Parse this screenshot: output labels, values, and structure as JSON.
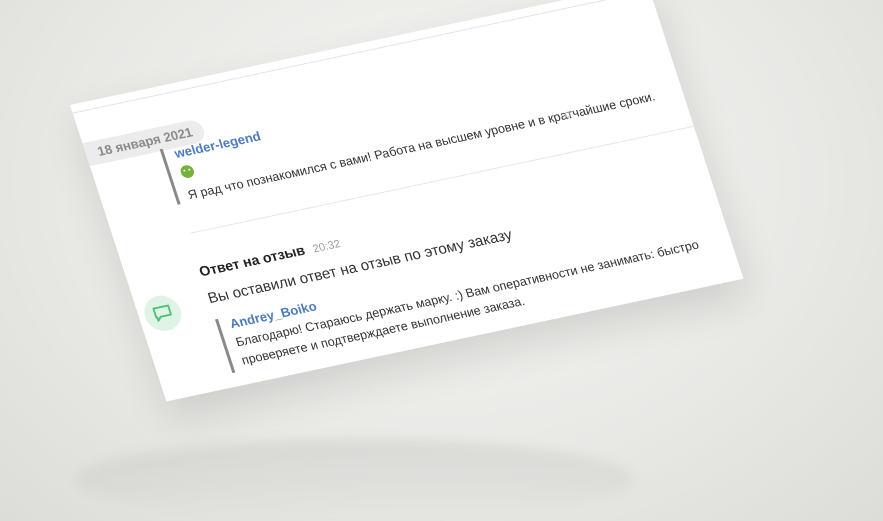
{
  "feed": {
    "date": "18 января 2021",
    "review": {
      "author": "welder-legend",
      "emoji": "smiley-icon",
      "text": "Я рад что познакомился с вами! Работа на высшем уровне и в кратчайшие  сроки."
    },
    "event": {
      "icon": "chat-bubble-icon",
      "title": "Ответ на отзыв",
      "time": "20:32",
      "description": "Вы оставили ответ на отзыв по этому заказу",
      "reply": {
        "author": "Andrey_Boiko",
        "line1": "Благодарю! Стараюсь держать марку. :) Вам оперативности не занимать: быстро",
        "line2": "проверяете и подтверждаете выполнение заказа."
      }
    }
  },
  "colors": {
    "author_link": "#4d7bc0",
    "emoji": "#74b23a",
    "event_icon_bg": "#dff4e6",
    "event_icon_stroke": "#4bbf73"
  }
}
